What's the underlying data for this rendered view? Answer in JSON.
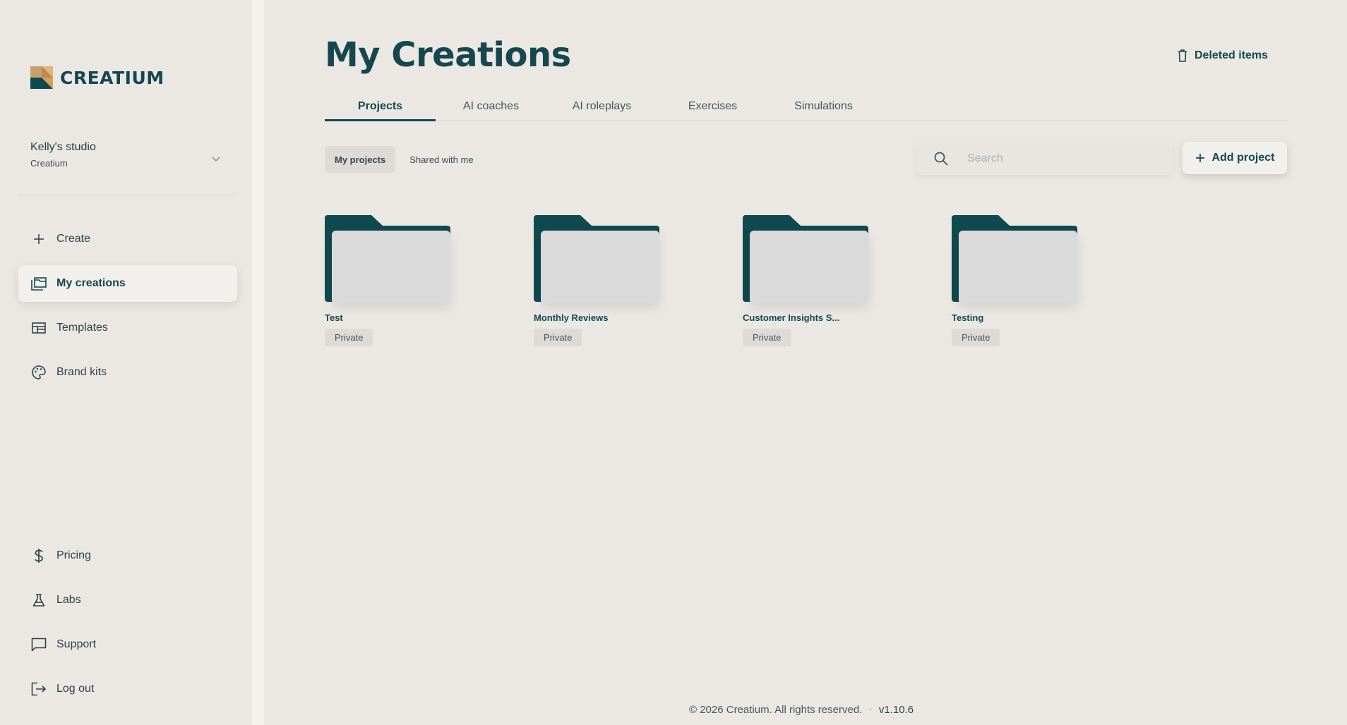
{
  "brand": {
    "name": "CREATIUM"
  },
  "studio": {
    "name": "Kelly's studio",
    "org": "Creatium"
  },
  "sidebar": {
    "items": [
      {
        "label": "Create",
        "icon": "plus-icon"
      },
      {
        "label": "My creations",
        "icon": "folders-icon"
      },
      {
        "label": "Templates",
        "icon": "templates-icon"
      },
      {
        "label": "Brand kits",
        "icon": "palette-icon"
      }
    ],
    "bottom_items": [
      {
        "label": "Pricing",
        "icon": "dollar-icon"
      },
      {
        "label": "Labs",
        "icon": "flask-icon"
      },
      {
        "label": "Support",
        "icon": "chat-icon"
      },
      {
        "label": "Log out",
        "icon": "logout-icon"
      }
    ]
  },
  "main": {
    "title": "My Creations",
    "deleted_label": "Deleted items",
    "tabs": [
      "Projects",
      "AI coaches",
      "AI roleplays",
      "Exercises",
      "Simulations"
    ],
    "subtabs": [
      "My projects",
      "Shared with me"
    ],
    "search_placeholder": "Search",
    "add_label": "Add project",
    "folders": [
      {
        "name": "Test",
        "visibility": "Private"
      },
      {
        "name": "Monthly Reviews",
        "visibility": "Private"
      },
      {
        "name": "Customer Insights S...",
        "visibility": "Private"
      },
      {
        "name": "Testing",
        "visibility": "Private"
      }
    ]
  },
  "footer": {
    "copyright": "© 2026 Creatium. All rights reserved.",
    "separator": "•",
    "version": "v1.10.6"
  },
  "colors": {
    "accent": "#16474e",
    "background": "#ebe8e4",
    "folder": "#0f4a4f"
  }
}
